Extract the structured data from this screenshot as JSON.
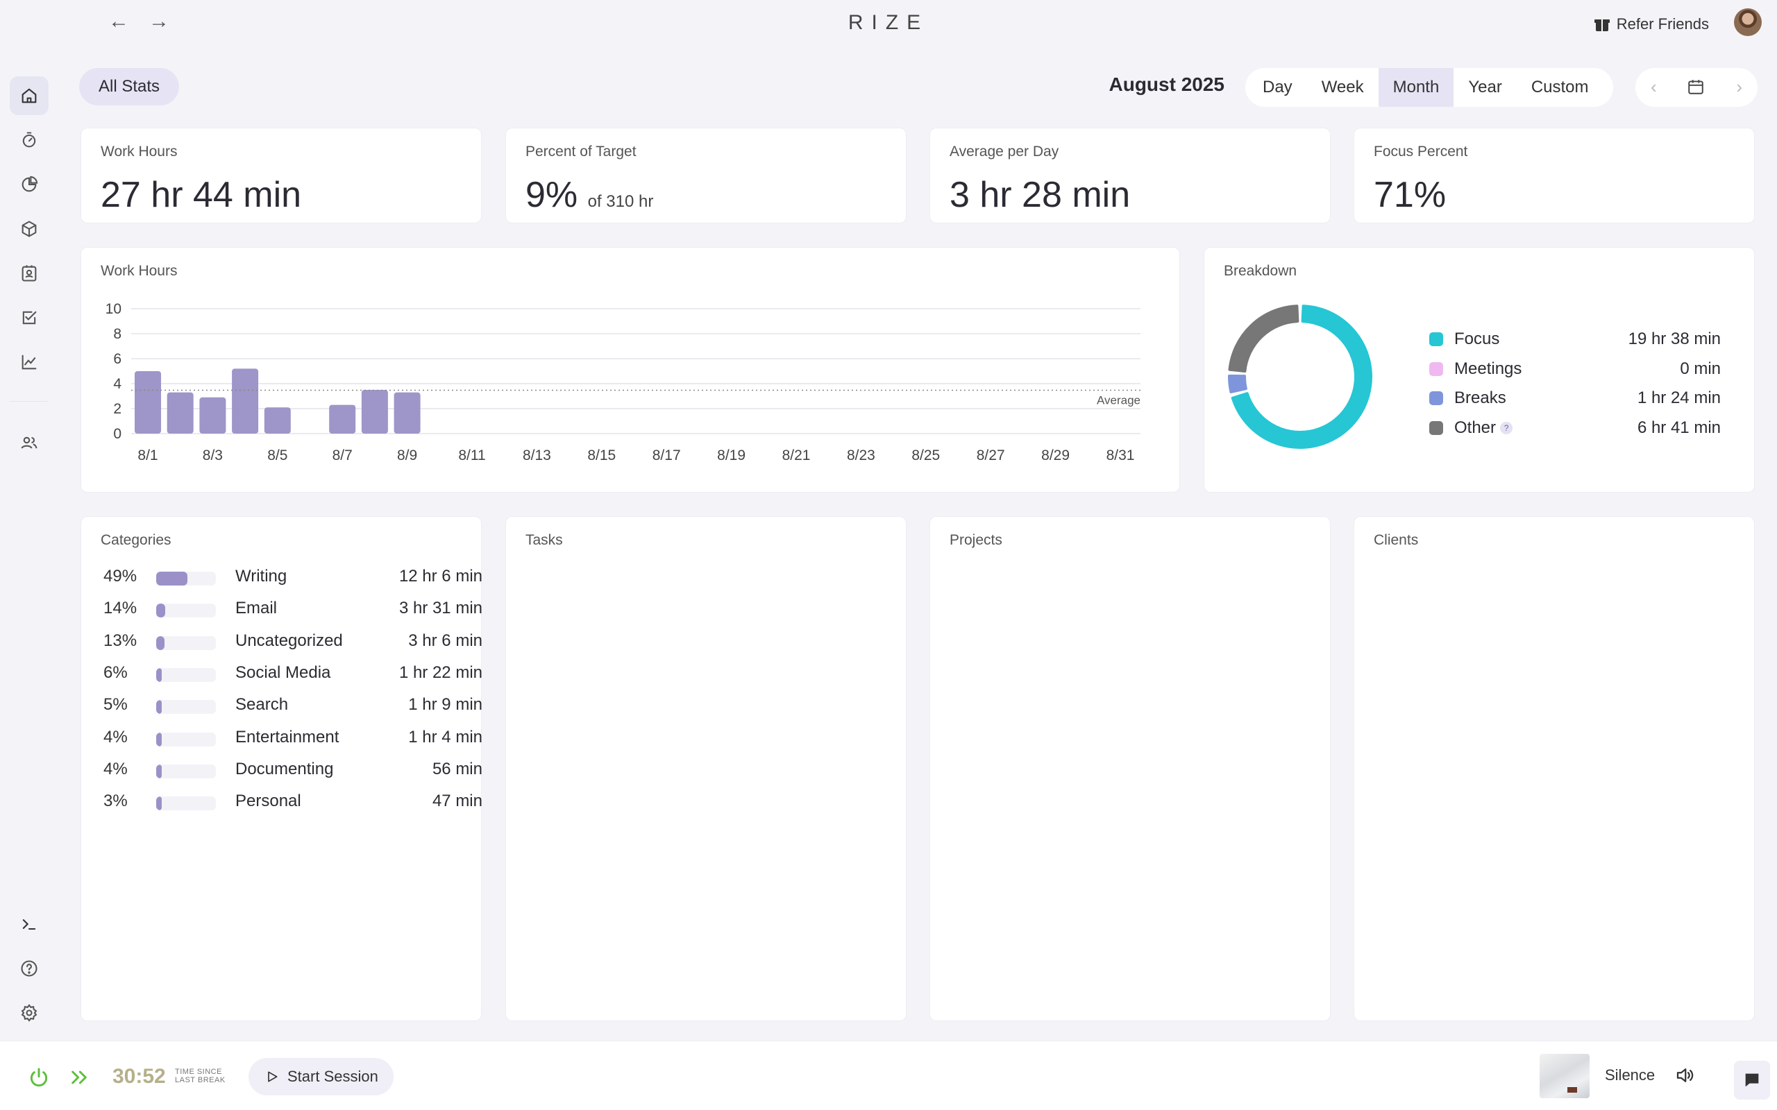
{
  "app": {
    "brand": "RIZE",
    "back_label": "←",
    "forward_label": "→",
    "refer_label": "Refer Friends"
  },
  "sidebar": {
    "items": [
      {
        "icon": "home-icon",
        "active": true
      },
      {
        "icon": "timer-icon"
      },
      {
        "icon": "pie-chart-icon"
      },
      {
        "icon": "cube-icon"
      },
      {
        "icon": "contact-card-icon"
      },
      {
        "icon": "checkbox-icon"
      },
      {
        "icon": "line-chart-icon"
      },
      {
        "icon": "users-icon"
      }
    ],
    "bottom_items": [
      {
        "icon": "terminal-icon"
      },
      {
        "icon": "help-icon"
      },
      {
        "icon": "settings-icon"
      }
    ]
  },
  "toolbar": {
    "all_stats_label": "All Stats",
    "period": "August 2025",
    "ranges": [
      "Day",
      "Week",
      "Month",
      "Year",
      "Custom"
    ],
    "active_range": "Month",
    "prev_label": "‹",
    "next_label": "›"
  },
  "stats": {
    "work_hours": {
      "label": "Work Hours",
      "value": "27 hr 44 min"
    },
    "percent_target": {
      "label": "Percent of Target",
      "value": "9%",
      "sub": "of 310 hr"
    },
    "avg_per_day": {
      "label": "Average per Day",
      "value": "3 hr 28 min"
    },
    "focus_percent": {
      "label": "Focus Percent",
      "value": "71%"
    }
  },
  "work_chart": {
    "title": "Work Hours",
    "average_label": "Average"
  },
  "chart_data": {
    "type": "bar",
    "title": "Work Hours",
    "categories": [
      "8/1",
      "8/2",
      "8/3",
      "8/4",
      "8/5",
      "8/6",
      "8/7",
      "8/8",
      "8/9",
      "8/10",
      "8/11",
      "8/12",
      "8/13",
      "8/14",
      "8/15",
      "8/16",
      "8/17",
      "8/18",
      "8/19",
      "8/20",
      "8/21",
      "8/22",
      "8/23",
      "8/24",
      "8/25",
      "8/26",
      "8/27",
      "8/28",
      "8/29",
      "8/30",
      "8/31"
    ],
    "tick_labels": [
      "8/1",
      "8/3",
      "8/5",
      "8/7",
      "8/9",
      "8/11",
      "8/13",
      "8/15",
      "8/17",
      "8/19",
      "8/21",
      "8/23",
      "8/25",
      "8/27",
      "8/29",
      "8/31"
    ],
    "values": [
      5.0,
      3.3,
      2.9,
      5.2,
      2.1,
      0,
      2.3,
      3.5,
      3.3,
      0,
      0,
      0,
      0,
      0,
      0,
      0,
      0,
      0,
      0,
      0,
      0,
      0,
      0,
      0,
      0,
      0,
      0,
      0,
      0,
      0,
      0
    ],
    "average": 3.47,
    "yticks": [
      0,
      2,
      4,
      6,
      8,
      10
    ],
    "ylim": [
      0,
      10
    ],
    "grid": true,
    "bar_color": "#9e95c9"
  },
  "breakdown": {
    "title": "Breakdown",
    "items": [
      {
        "name": "Focus",
        "value": "19 hr 38 min",
        "minutes": 1178,
        "color": "#26c6d4"
      },
      {
        "name": "Meetings",
        "value": "0 min",
        "minutes": 0,
        "color": "#f0b8f0"
      },
      {
        "name": "Breaks",
        "value": "1 hr 24 min",
        "minutes": 84,
        "color": "#7f95db"
      },
      {
        "name": "Other",
        "value": "6 hr 41 min",
        "minutes": 401,
        "color": "#777777"
      }
    ],
    "help_glyph": "?"
  },
  "categories": {
    "title": "Categories",
    "items": [
      {
        "pct": "49%",
        "fraction": 0.49,
        "name": "Writing",
        "value": "12 hr 6 min"
      },
      {
        "pct": "14%",
        "fraction": 0.14,
        "name": "Email",
        "value": "3 hr 31 min"
      },
      {
        "pct": "13%",
        "fraction": 0.13,
        "name": "Uncategorized",
        "value": "3 hr 6 min"
      },
      {
        "pct": "6%",
        "fraction": 0.06,
        "name": "Social Media",
        "value": "1 hr 22 min"
      },
      {
        "pct": "5%",
        "fraction": 0.05,
        "name": "Search",
        "value": "1 hr 9 min"
      },
      {
        "pct": "4%",
        "fraction": 0.04,
        "name": "Entertainment",
        "value": "1 hr 4 min"
      },
      {
        "pct": "4%",
        "fraction": 0.04,
        "name": "Documenting",
        "value": "56 min"
      },
      {
        "pct": "3%",
        "fraction": 0.03,
        "name": "Personal",
        "value": "47 min"
      }
    ]
  },
  "panels": {
    "tasks_title": "Tasks",
    "projects_title": "Projects",
    "clients_title": "Clients"
  },
  "bottom": {
    "timer": "30:52",
    "timer_caption_1": "TIME SINCE",
    "timer_caption_2": "LAST BREAK",
    "start_label": "Start Session",
    "sound_label": "Silence"
  }
}
